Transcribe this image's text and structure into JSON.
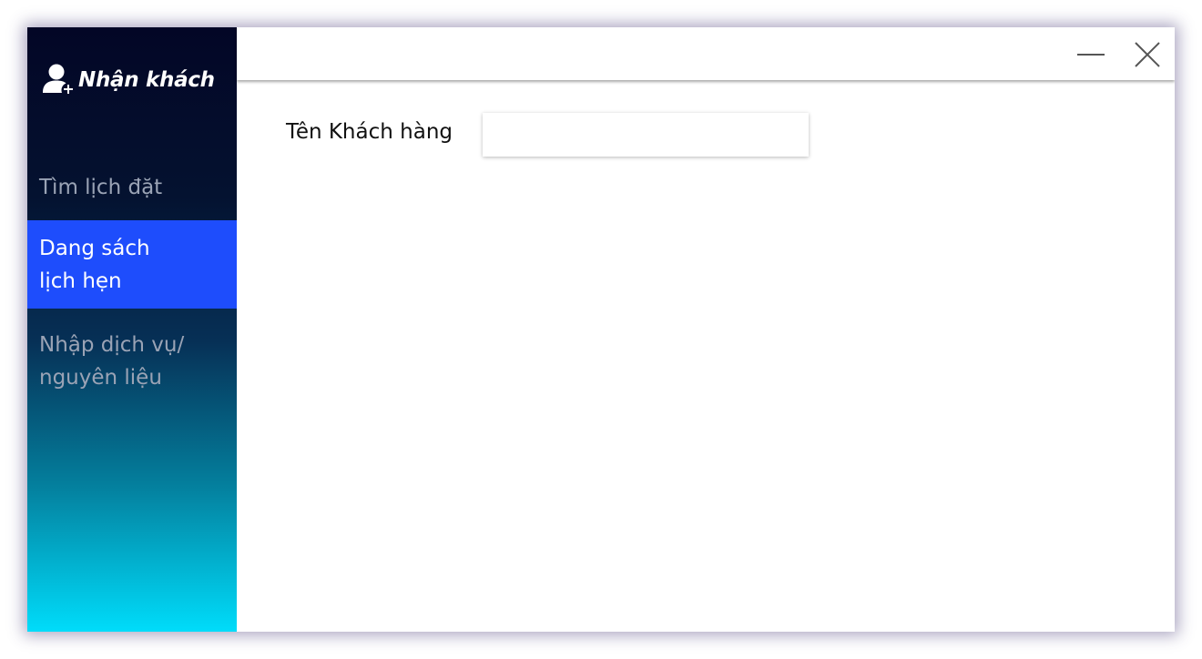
{
  "app": {
    "title": "Nhận khách",
    "icon": "add-user-icon"
  },
  "sidebar": {
    "items": [
      {
        "label": "Tìm lịch đặt",
        "active": false
      },
      {
        "label": "Dang sách\nlịch hẹn",
        "active": true
      },
      {
        "label": "Nhập dịch vụ/\nnguyên liệu",
        "active": false
      }
    ]
  },
  "titlebar": {
    "minimize_icon": "minimize-icon",
    "close_icon": "close-icon"
  },
  "form": {
    "customer_name_label": "Tên Khách hàng",
    "customer_name_value": "",
    "customer_name_placeholder": ""
  },
  "colors": {
    "sidebar_top": "#030626",
    "sidebar_bottom": "#00dcfa",
    "active_item": "#1e4dfc",
    "inactive_text": "#9aa3b5"
  }
}
